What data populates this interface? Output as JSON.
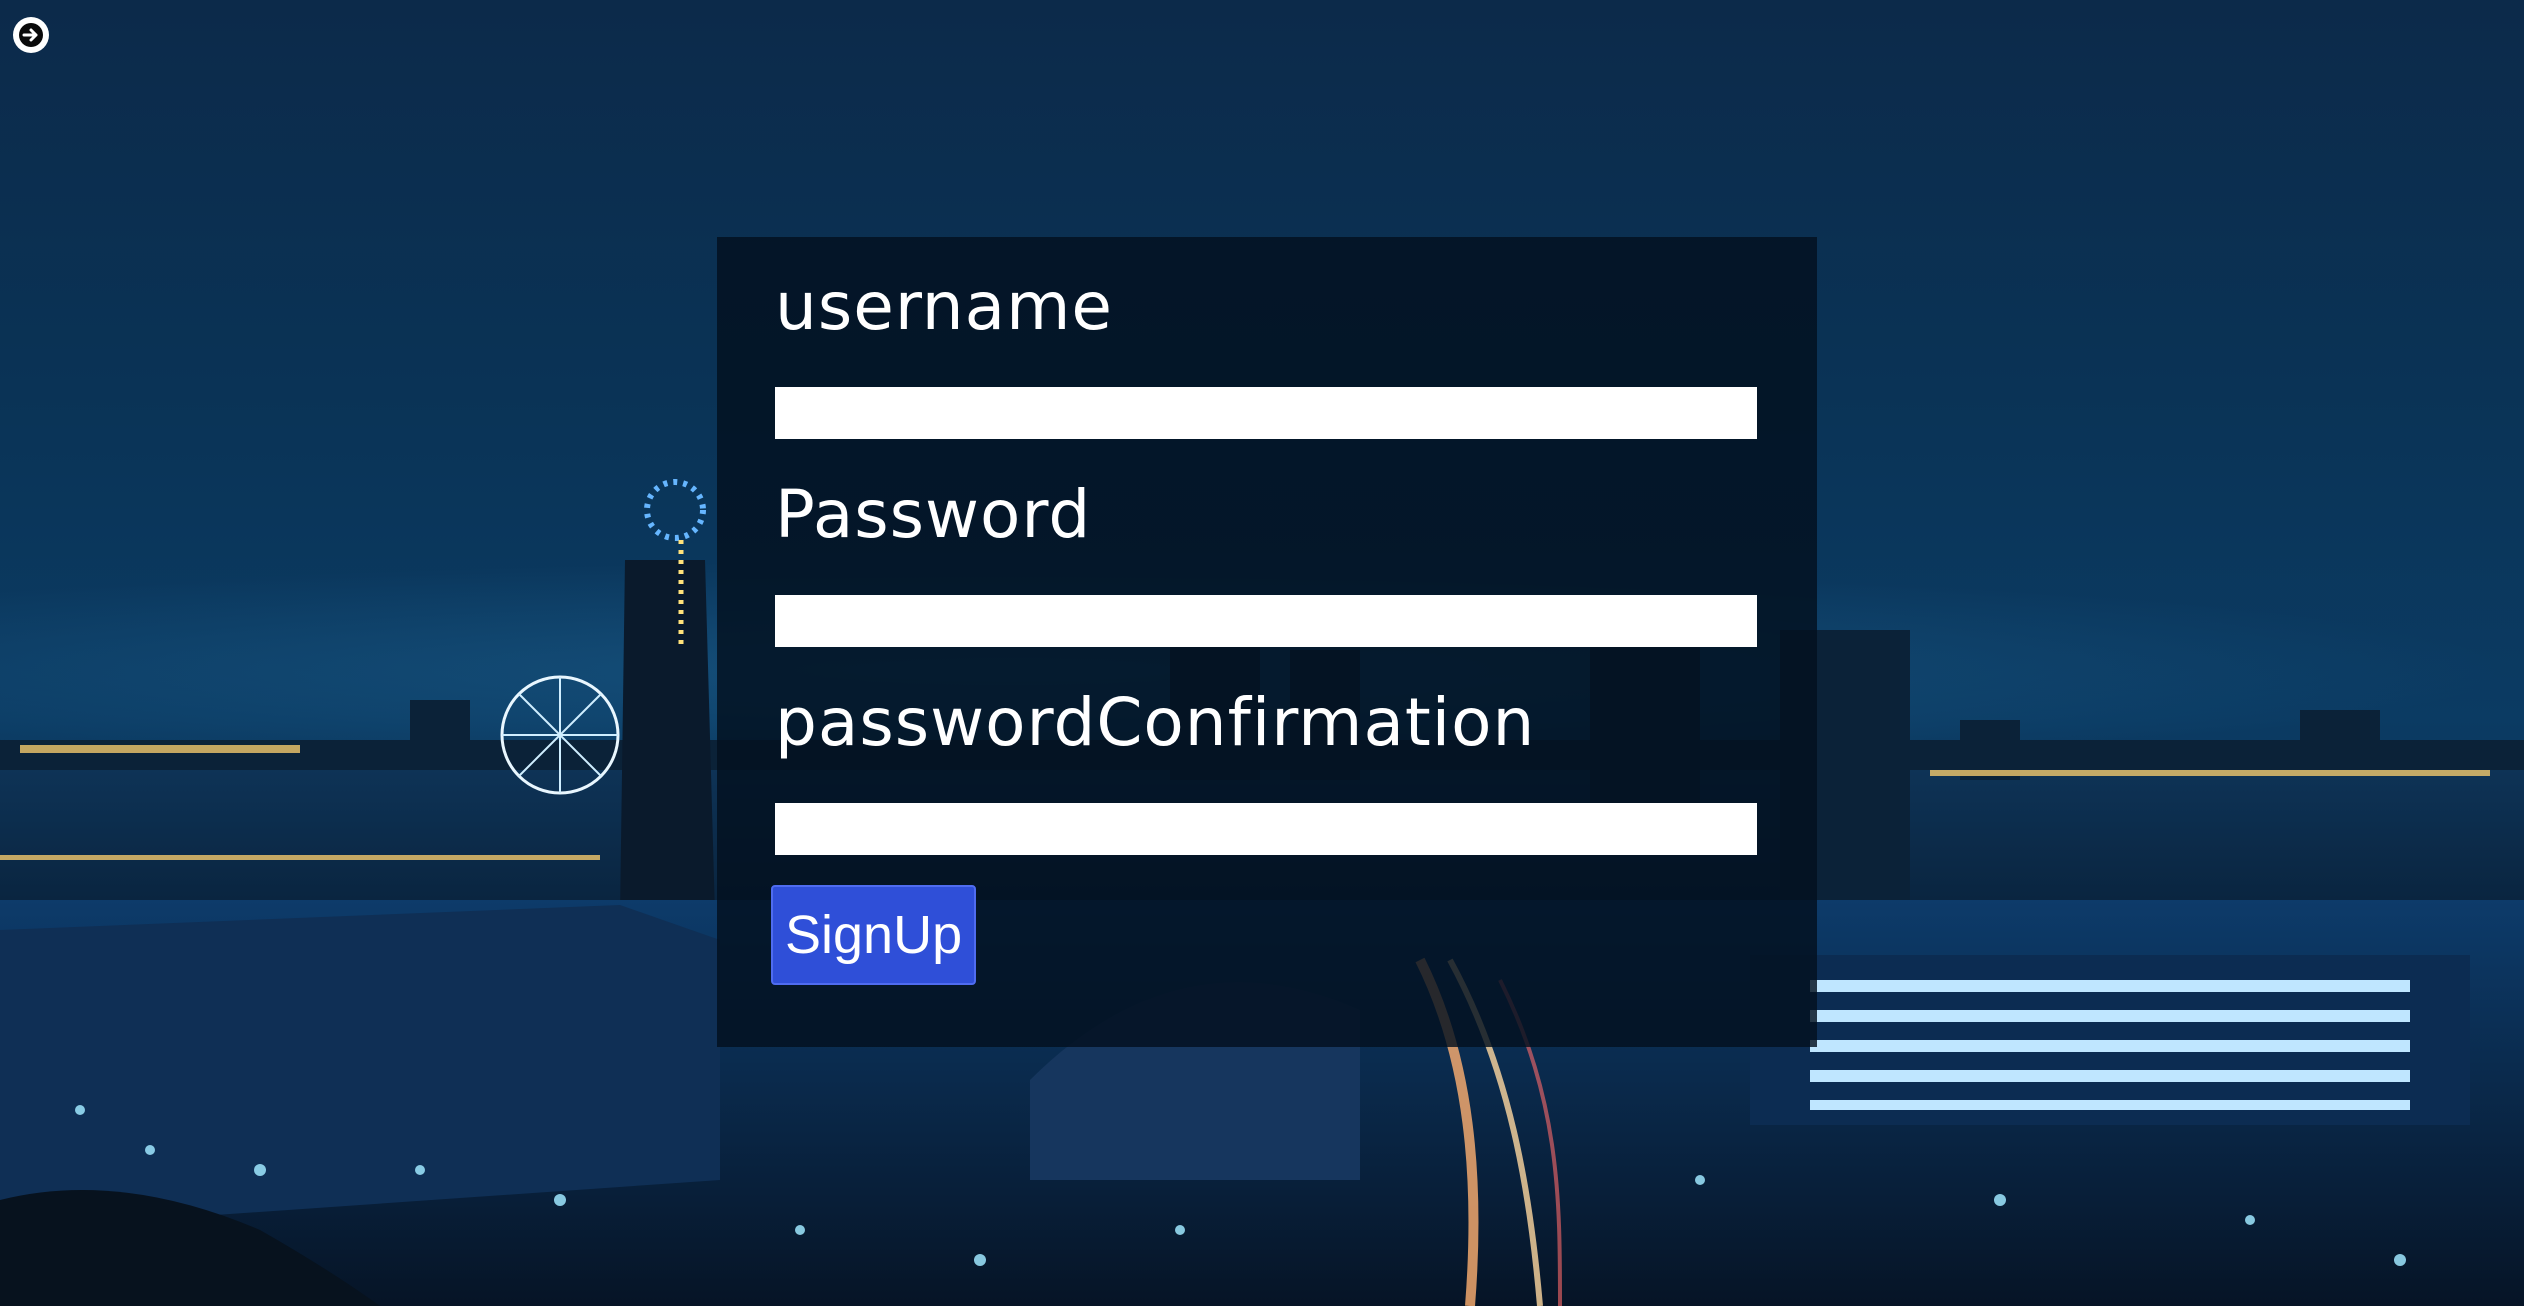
{
  "icons": {
    "back": "arrow-right-circle-icon"
  },
  "form": {
    "username_label": "username",
    "username_value": "",
    "password_label": "Password",
    "password_value": "",
    "confirmation_label": "passwordConfirmation",
    "confirmation_value": "",
    "submit_label": "SignUp"
  },
  "colors": {
    "panel": "#03101e",
    "button": "#2f4fd8",
    "input": "#ffffff",
    "text": "#ffffff"
  }
}
